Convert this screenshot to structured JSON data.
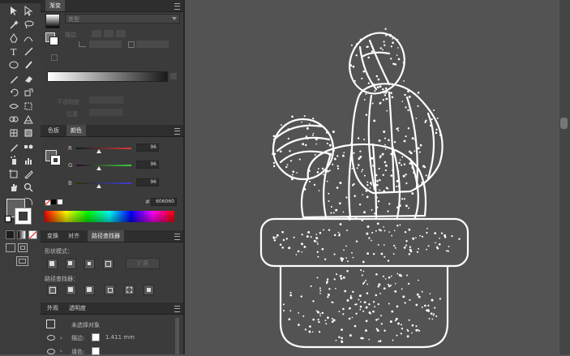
{
  "gradient_panel": {
    "tab_label": "渐变",
    "type_value": "类型",
    "stroke_label": "描边",
    "opacity_label": "不透明度",
    "position_label": "位置"
  },
  "color_panel": {
    "tabs": [
      "色板",
      "颜色"
    ],
    "channels": [
      {
        "name": "R",
        "value": "96"
      },
      {
        "name": "G",
        "value": "96"
      },
      {
        "name": "B",
        "value": "96"
      }
    ],
    "hex_value": "606060"
  },
  "pathfinder_panel": {
    "tabs": [
      "变换",
      "对齐",
      "路径查找器"
    ],
    "shape_modes_label": "形状模式：",
    "expand_label": "扩展",
    "pathfinders_label": "路径查找器："
  },
  "appearance_panel": {
    "tabs": [
      "外观",
      "透明度"
    ],
    "object_label": "未选择对象",
    "stroke_label": "描边:",
    "stroke_weight": "1.411 mm",
    "fill_label": "填色:"
  },
  "icons": [
    "selection-tool-icon",
    "direct-selection-tool-icon",
    "magic-wand-icon",
    "lasso-icon",
    "pen-tool-icon",
    "curvature-tool-icon",
    "type-tool-icon",
    "line-tool-icon",
    "ellipse-tool-icon",
    "paintbrush-icon",
    "pencil-icon",
    "eraser-icon",
    "rotate-icon",
    "scale-icon",
    "width-tool-icon",
    "free-transform-icon",
    "shape-builder-icon",
    "perspective-grid-icon",
    "mesh-icon",
    "gradient-icon",
    "eyedropper-icon",
    "blend-icon",
    "symbol-sprayer-icon",
    "column-graph-icon",
    "artboard-icon",
    "slice-icon",
    "hand-icon",
    "zoom-icon"
  ],
  "colors": {
    "canvas": "#535353",
    "panel": "#3b3b3b",
    "toolbar": "#3c3c3c",
    "artwork_stroke": "#ffffff",
    "fill_color": "#606060"
  }
}
